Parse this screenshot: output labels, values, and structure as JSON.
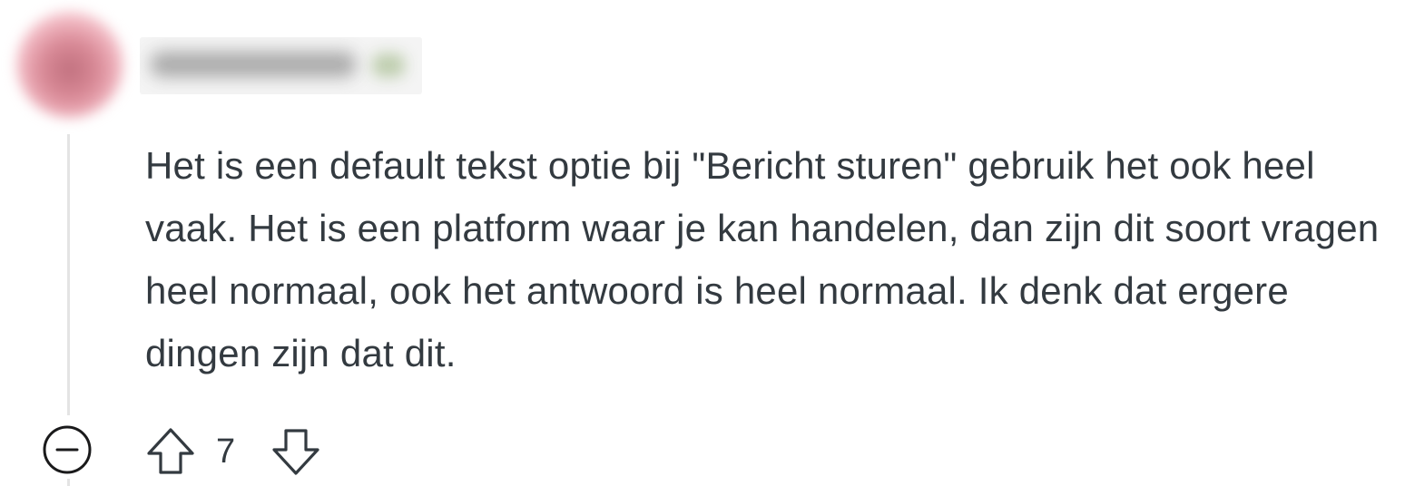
{
  "comment": {
    "author_redacted": true,
    "body": "Het is een default tekst optie bij \"Bericht sturen\" gebruik het ook heel vaak. Het is een platform waar je kan handelen, dan zijn dit soort vragen heel normaal, ook het antwoord is heel normaal. Ik denk dat ergere dingen zijn dat dit.",
    "score": "7"
  },
  "icons": {
    "collapse": "minus-circle-icon",
    "upvote": "arrow-up-outline-icon",
    "downvote": "arrow-down-outline-icon"
  },
  "colors": {
    "text": "#333a40",
    "thread_line": "#e4e4e4",
    "icon": "#333a40"
  }
}
